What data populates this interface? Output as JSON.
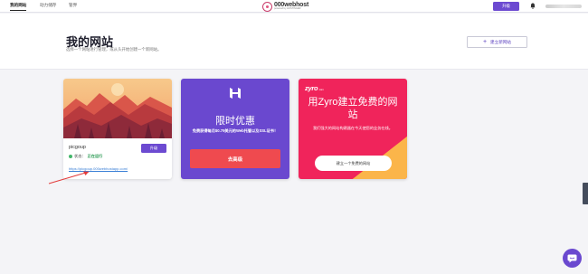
{
  "nav": {
    "items": [
      {
        "label": "我的网站",
        "active": true
      },
      {
        "label": "动力储存",
        "active": false
      },
      {
        "label": "管界",
        "active": false
      }
    ],
    "logo_text": "000webhost",
    "logo_sub": "powered by HOSTINGER",
    "upgrade_label": "升级",
    "bell_icon": "bell-icon"
  },
  "header": {
    "title": "我的网站",
    "subtitle": "选择一个网站进行管理，或从头开始创建一个新网站。",
    "new_site_label": "建立新网站",
    "new_site_icon": "plus-icon"
  },
  "site_card": {
    "name": "picgoup",
    "status_label": "状态：",
    "status_value": "正在运行",
    "upgrade_label": "升级",
    "url": "https://picgoup.000webhostapp.com/"
  },
  "promo_card": {
    "title": "限时优惠",
    "description": "免费获得每月$0.79美元的Web托管以及SSL证书！",
    "button_label": "去高级"
  },
  "zyro_card": {
    "logo": "zyro",
    "logo_sub": ".com",
    "title": "用Zyro建立免费的网站",
    "description": "我们强大的网站构建器在今天使您的业务在线。",
    "button_label": "建立一个免费的网站"
  },
  "colors": {
    "brand_purple": "#6c4ad1",
    "promo_red": "#ef4a4f",
    "zyro_pink": "#f0245b",
    "status_green": "#43b66a"
  }
}
